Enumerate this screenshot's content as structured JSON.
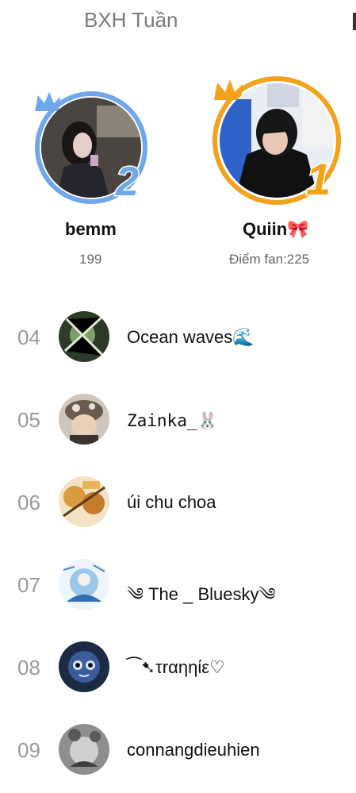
{
  "header": {
    "tab_title": "BXH Tuần"
  },
  "podium": [
    {
      "rank": "2",
      "name": "bemm",
      "score": "199"
    },
    {
      "rank": "1",
      "name": "Quiin🎀",
      "score": "Điểm fan:225"
    }
  ],
  "ranking": [
    {
      "rank": "04",
      "name": "Ocean waves🌊"
    },
    {
      "rank": "05",
      "name": "Zainka_🐰"
    },
    {
      "rank": "06",
      "name": "úi chu choa"
    },
    {
      "rank": "07",
      "name": "༄ The _ Bluesky༄"
    },
    {
      "rank": "08",
      "name": "⁀➷τrαηηίε♡"
    },
    {
      "rank": "09",
      "name": "connangdieuhien"
    }
  ],
  "colors": {
    "silver": "#6ea8ea",
    "gold": "#f4a11c",
    "rank_text": "#9a9a9a"
  }
}
